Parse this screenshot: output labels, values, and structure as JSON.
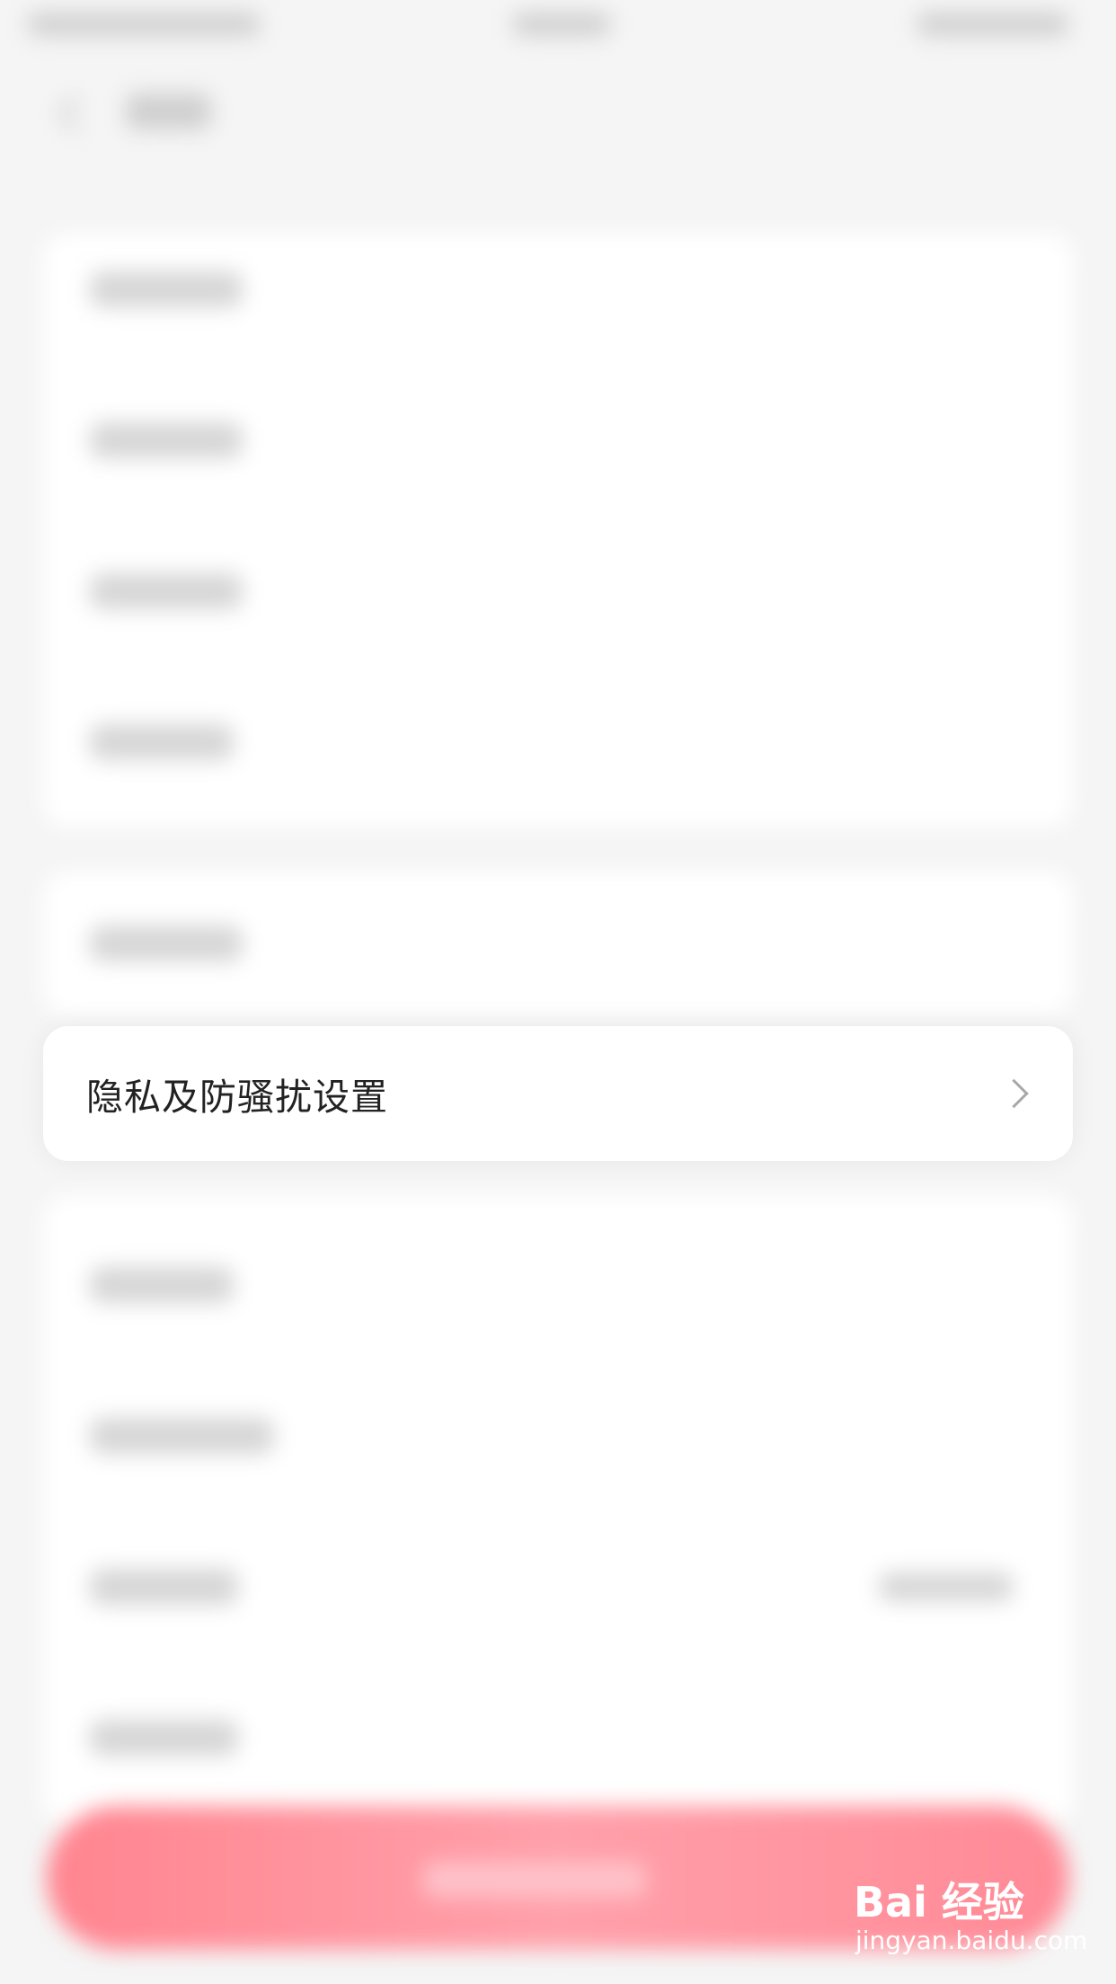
{
  "highlighted_row": {
    "label": "隐私及防骚扰设置",
    "trailing_icon": "chevron-right-icon"
  },
  "watermark": {
    "logo_text": "Bai 经验",
    "url": "jingyan.baidu.com"
  },
  "colors": {
    "background": "#f5f5f5",
    "card": "#ffffff",
    "accent_button": "#ff8d98",
    "text_primary": "#222222",
    "chevron": "#a8a8a8"
  }
}
